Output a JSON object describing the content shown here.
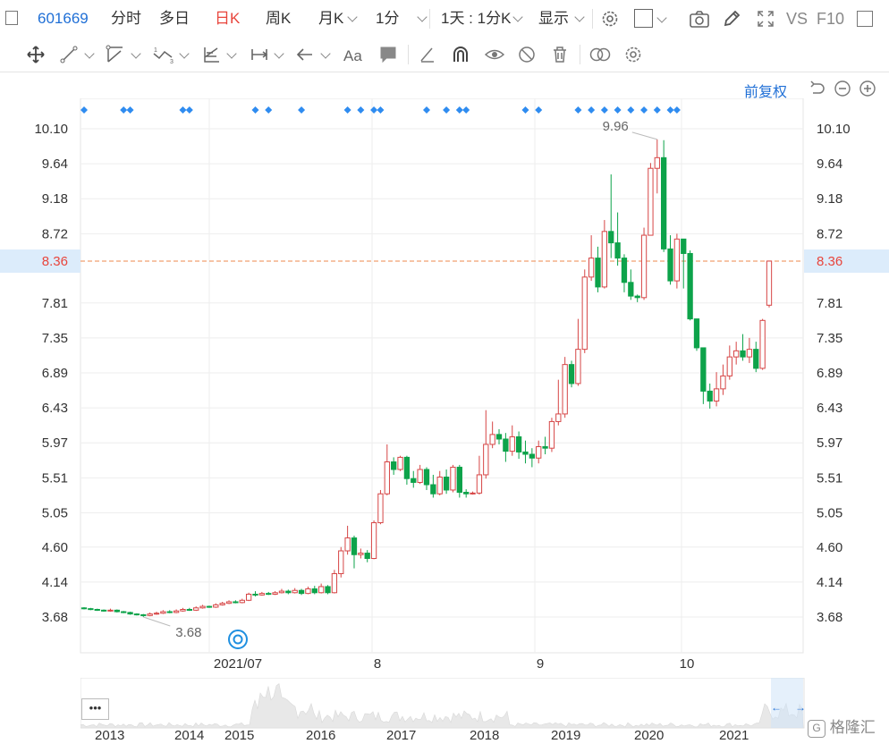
{
  "toolbar": {
    "symbol": "601669",
    "periods": [
      {
        "label": "分时",
        "active": false,
        "dropdown": false
      },
      {
        "label": "多日",
        "active": false,
        "dropdown": false
      },
      {
        "label": "日K",
        "active": true,
        "dropdown": false
      },
      {
        "label": "周K",
        "active": false,
        "dropdown": false
      },
      {
        "label": "月K",
        "active": false,
        "dropdown": true
      },
      {
        "label": "1分",
        "active": false,
        "dropdown": true
      }
    ],
    "multi_period": "1天 : 1分K",
    "display": "显示",
    "vs": "VS",
    "f10": "F10"
  },
  "drawing_tools": [
    "move-icon",
    "line-icon",
    "polyline-icon",
    "wave-icon",
    "fib-icon",
    "range-icon",
    "arrow-icon",
    "text-icon",
    "comment-icon",
    "ruler-icon",
    "magnet-icon",
    "eye-lock-icon",
    "eye-off-icon",
    "trash-icon",
    "compare-icon",
    "settings-icon"
  ],
  "chart": {
    "adjust_label": "前复权",
    "current_price": "8.36",
    "high_label": "9.96",
    "low_label": "3.68",
    "colors": {
      "up": "#d64545",
      "down": "#0da34a",
      "current": "#e8453c",
      "marker": "#2f8cf0",
      "grid": "#eeeeee",
      "dash": "#f0a070"
    }
  },
  "chart_data": {
    "type": "candlestick",
    "y_ticks": [
      "10.10",
      "9.64",
      "9.18",
      "8.72",
      "8.36",
      "7.81",
      "7.35",
      "6.89",
      "6.43",
      "5.97",
      "5.51",
      "5.05",
      "4.60",
      "4.14",
      "3.68"
    ],
    "ylim": [
      3.22,
      10.56
    ],
    "x_ticks": [
      "2021/07",
      "8",
      "9",
      "10"
    ],
    "candles": [
      [
        3.8,
        3.79,
        3.81,
        3.78
      ],
      [
        3.79,
        3.78,
        3.8,
        3.77
      ],
      [
        3.78,
        3.77,
        3.79,
        3.76
      ],
      [
        3.77,
        3.76,
        3.78,
        3.75
      ],
      [
        3.76,
        3.77,
        3.79,
        3.75
      ],
      [
        3.77,
        3.75,
        3.78,
        3.74
      ],
      [
        3.75,
        3.74,
        3.76,
        3.73
      ],
      [
        3.74,
        3.72,
        3.75,
        3.71
      ],
      [
        3.72,
        3.71,
        3.73,
        3.7
      ],
      [
        3.71,
        3.7,
        3.72,
        3.68
      ],
      [
        3.7,
        3.72,
        3.74,
        3.69
      ],
      [
        3.72,
        3.73,
        3.75,
        3.71
      ],
      [
        3.73,
        3.75,
        3.77,
        3.72
      ],
      [
        3.75,
        3.74,
        3.77,
        3.73
      ],
      [
        3.74,
        3.76,
        3.78,
        3.73
      ],
      [
        3.76,
        3.78,
        3.8,
        3.75
      ],
      [
        3.78,
        3.77,
        3.8,
        3.76
      ],
      [
        3.77,
        3.8,
        3.82,
        3.76
      ],
      [
        3.8,
        3.82,
        3.84,
        3.79
      ],
      [
        3.82,
        3.81,
        3.83,
        3.8
      ],
      [
        3.81,
        3.84,
        3.86,
        3.8
      ],
      [
        3.84,
        3.86,
        3.88,
        3.83
      ],
      [
        3.86,
        3.88,
        3.9,
        3.85
      ],
      [
        3.88,
        3.87,
        3.9,
        3.86
      ],
      [
        3.87,
        3.9,
        3.92,
        3.86
      ],
      [
        3.9,
        3.98,
        4.0,
        3.89
      ],
      [
        3.98,
        3.97,
        4.02,
        3.95
      ],
      [
        3.97,
        3.99,
        4.01,
        3.96
      ],
      [
        3.99,
        3.98,
        4.01,
        3.97
      ],
      [
        3.98,
        4.0,
        4.02,
        3.97
      ],
      [
        4.0,
        4.02,
        4.05,
        3.99
      ],
      [
        4.02,
        4.0,
        4.04,
        3.98
      ],
      [
        4.0,
        4.03,
        4.06,
        3.99
      ],
      [
        4.03,
        3.99,
        4.05,
        3.97
      ],
      [
        3.99,
        4.05,
        4.08,
        3.98
      ],
      [
        4.05,
        4.0,
        4.09,
        3.98
      ],
      [
        4.0,
        4.08,
        4.12,
        3.99
      ],
      [
        4.08,
        4.0,
        4.1,
        3.98
      ],
      [
        4.0,
        4.25,
        4.3,
        3.99
      ],
      [
        4.25,
        4.55,
        4.6,
        4.2
      ],
      [
        4.55,
        4.72,
        4.88,
        4.5
      ],
      [
        4.72,
        4.5,
        4.75,
        4.32
      ],
      [
        4.5,
        4.52,
        4.58,
        4.45
      ],
      [
        4.52,
        4.45,
        4.56,
        4.4
      ],
      [
        4.45,
        4.92,
        4.95,
        4.44
      ],
      [
        4.92,
        5.3,
        5.35,
        4.9
      ],
      [
        5.3,
        5.72,
        5.95,
        5.28
      ],
      [
        5.72,
        5.62,
        5.78,
        5.55
      ],
      [
        5.62,
        5.78,
        5.8,
        5.6
      ],
      [
        5.78,
        5.5,
        5.8,
        5.42
      ],
      [
        5.5,
        5.45,
        5.6,
        5.38
      ],
      [
        5.45,
        5.62,
        5.68,
        5.43
      ],
      [
        5.62,
        5.42,
        5.65,
        5.35
      ],
      [
        5.42,
        5.3,
        5.55,
        5.25
      ],
      [
        5.3,
        5.52,
        5.6,
        5.28
      ],
      [
        5.52,
        5.35,
        5.62,
        5.3
      ],
      [
        5.35,
        5.65,
        5.68,
        5.32
      ],
      [
        5.65,
        5.32,
        5.68,
        5.25
      ],
      [
        5.32,
        5.3,
        5.36,
        5.25
      ],
      [
        5.3,
        5.31,
        5.33,
        5.29
      ],
      [
        5.31,
        5.55,
        5.8,
        5.29
      ],
      [
        5.55,
        5.95,
        6.4,
        5.5
      ],
      [
        5.95,
        6.08,
        6.25,
        5.9
      ],
      [
        6.08,
        6.02,
        6.15,
        5.95
      ],
      [
        6.02,
        5.86,
        6.1,
        5.72
      ],
      [
        5.86,
        6.05,
        6.2,
        5.8
      ],
      [
        6.05,
        5.85,
        6.12,
        5.76
      ],
      [
        5.85,
        5.82,
        6.0,
        5.7
      ],
      [
        5.82,
        5.77,
        5.9,
        5.65
      ],
      [
        5.77,
        5.92,
        6.0,
        5.7
      ],
      [
        5.92,
        5.9,
        6.05,
        5.82
      ],
      [
        5.9,
        6.25,
        6.3,
        5.85
      ],
      [
        6.25,
        6.35,
        6.8,
        6.2
      ],
      [
        6.35,
        7.0,
        7.1,
        6.3
      ],
      [
        7.0,
        6.75,
        7.05,
        6.7
      ],
      [
        6.75,
        7.2,
        7.6,
        6.72
      ],
      [
        7.2,
        8.15,
        8.25,
        7.15
      ],
      [
        8.15,
        8.4,
        8.7,
        8.1
      ],
      [
        8.4,
        8.02,
        8.55,
        7.95
      ],
      [
        8.02,
        8.75,
        8.9,
        8.0
      ],
      [
        8.75,
        8.6,
        9.5,
        8.4
      ],
      [
        8.6,
        8.4,
        9.0,
        8.3
      ],
      [
        8.4,
        8.08,
        8.45,
        7.95
      ],
      [
        8.08,
        7.9,
        8.25,
        7.85
      ],
      [
        7.9,
        7.88,
        7.92,
        7.82
      ],
      [
        7.88,
        8.7,
        8.8,
        7.85
      ],
      [
        8.7,
        9.58,
        9.65,
        8.7
      ],
      [
        9.58,
        9.72,
        9.96,
        9.25
      ],
      [
        9.72,
        8.52,
        9.95,
        8.48
      ],
      [
        8.52,
        8.1,
        8.7,
        8.05
      ],
      [
        8.1,
        8.65,
        8.72,
        8.0
      ],
      [
        8.65,
        8.46,
        8.5,
        8.0
      ],
      [
        8.46,
        7.6,
        8.5,
        7.58
      ],
      [
        7.6,
        7.22,
        7.3,
        7.18
      ],
      [
        7.22,
        6.65,
        7.1,
        6.48
      ],
      [
        6.65,
        6.52,
        6.75,
        6.42
      ],
      [
        6.52,
        6.68,
        6.9,
        6.45
      ],
      [
        6.68,
        6.85,
        7.0,
        6.6
      ],
      [
        6.85,
        7.1,
        7.25,
        6.8
      ],
      [
        7.1,
        7.18,
        7.3,
        7.0
      ],
      [
        7.18,
        7.1,
        7.4,
        7.05
      ],
      [
        7.1,
        7.2,
        7.35,
        7.02
      ],
      [
        7.2,
        6.95,
        7.3,
        6.9
      ],
      [
        6.95,
        7.58,
        7.6,
        6.93
      ],
      [
        7.78,
        8.36,
        8.36,
        7.75
      ]
    ],
    "markers": [
      0,
      6,
      7,
      15,
      16,
      26,
      28,
      33,
      40,
      42,
      44,
      45,
      52,
      55,
      57,
      58,
      67,
      69,
      75,
      77,
      79,
      81,
      83,
      85,
      87,
      89,
      90
    ]
  },
  "navigator": {
    "years": [
      "2013",
      "2014",
      "2015",
      "2016",
      "2017",
      "2018",
      "2019",
      "2020",
      "2021"
    ],
    "menu": "•••",
    "left_arrow": "←",
    "right_arrow": "→"
  },
  "watermark": "格隆汇"
}
